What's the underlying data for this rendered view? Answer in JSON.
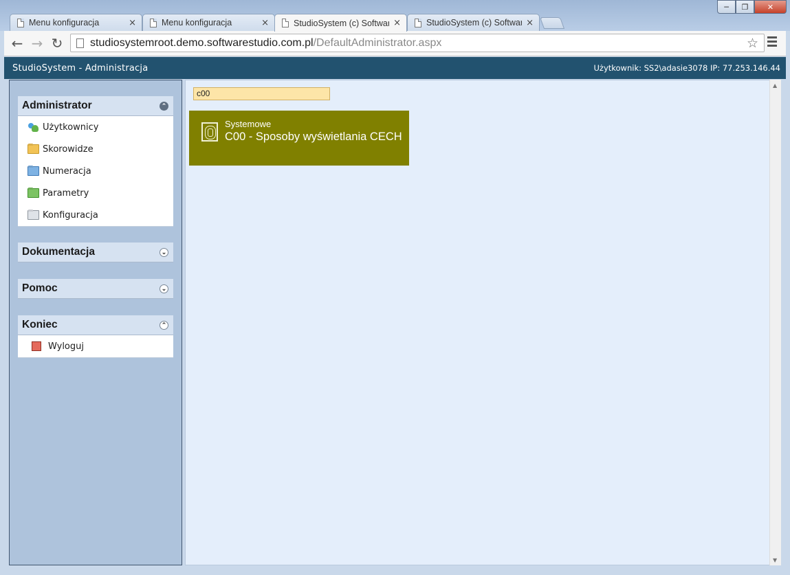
{
  "browser": {
    "tabs": [
      {
        "title": "Menu konfiguracja",
        "active": false
      },
      {
        "title": "Menu konfiguracja",
        "active": false
      },
      {
        "title": "StudioSystem (c) Software",
        "active": true
      },
      {
        "title": "StudioSystem (c) Software",
        "active": false
      }
    ],
    "close_glyph": "×",
    "url_host": "studiosystemroot.demo.softwarestudio.com.pl",
    "url_path": "/DefaultAdministrator.aspx"
  },
  "header": {
    "title": "StudioSystem - Administracja",
    "user_info": "Użytkownik: SS2\\adasie3078 IP: 77.253.146.44"
  },
  "sidebar": {
    "administrator": {
      "title": "Administrator",
      "items": [
        {
          "label": "Użytkownicy",
          "icon": "users-icon"
        },
        {
          "label": "Skorowidze",
          "icon": "folder-yellow-icon"
        },
        {
          "label": "Numeracja",
          "icon": "folder-blue-icon"
        },
        {
          "label": "Parametry",
          "icon": "folder-green-icon"
        },
        {
          "label": "Konfiguracja",
          "icon": "folder-gray-icon"
        }
      ]
    },
    "dokumentacja": {
      "title": "Dokumentacja"
    },
    "pomoc": {
      "title": "Pomoc"
    },
    "koniec": {
      "title": "Koniec",
      "items": [
        {
          "label": "Wyloguj",
          "icon": "logout-icon"
        }
      ]
    }
  },
  "main": {
    "search_value": "c00",
    "tile": {
      "category": "Systemowe",
      "title": "C00 - Sposoby wyświetlania CECH",
      "color": "#808000"
    }
  }
}
